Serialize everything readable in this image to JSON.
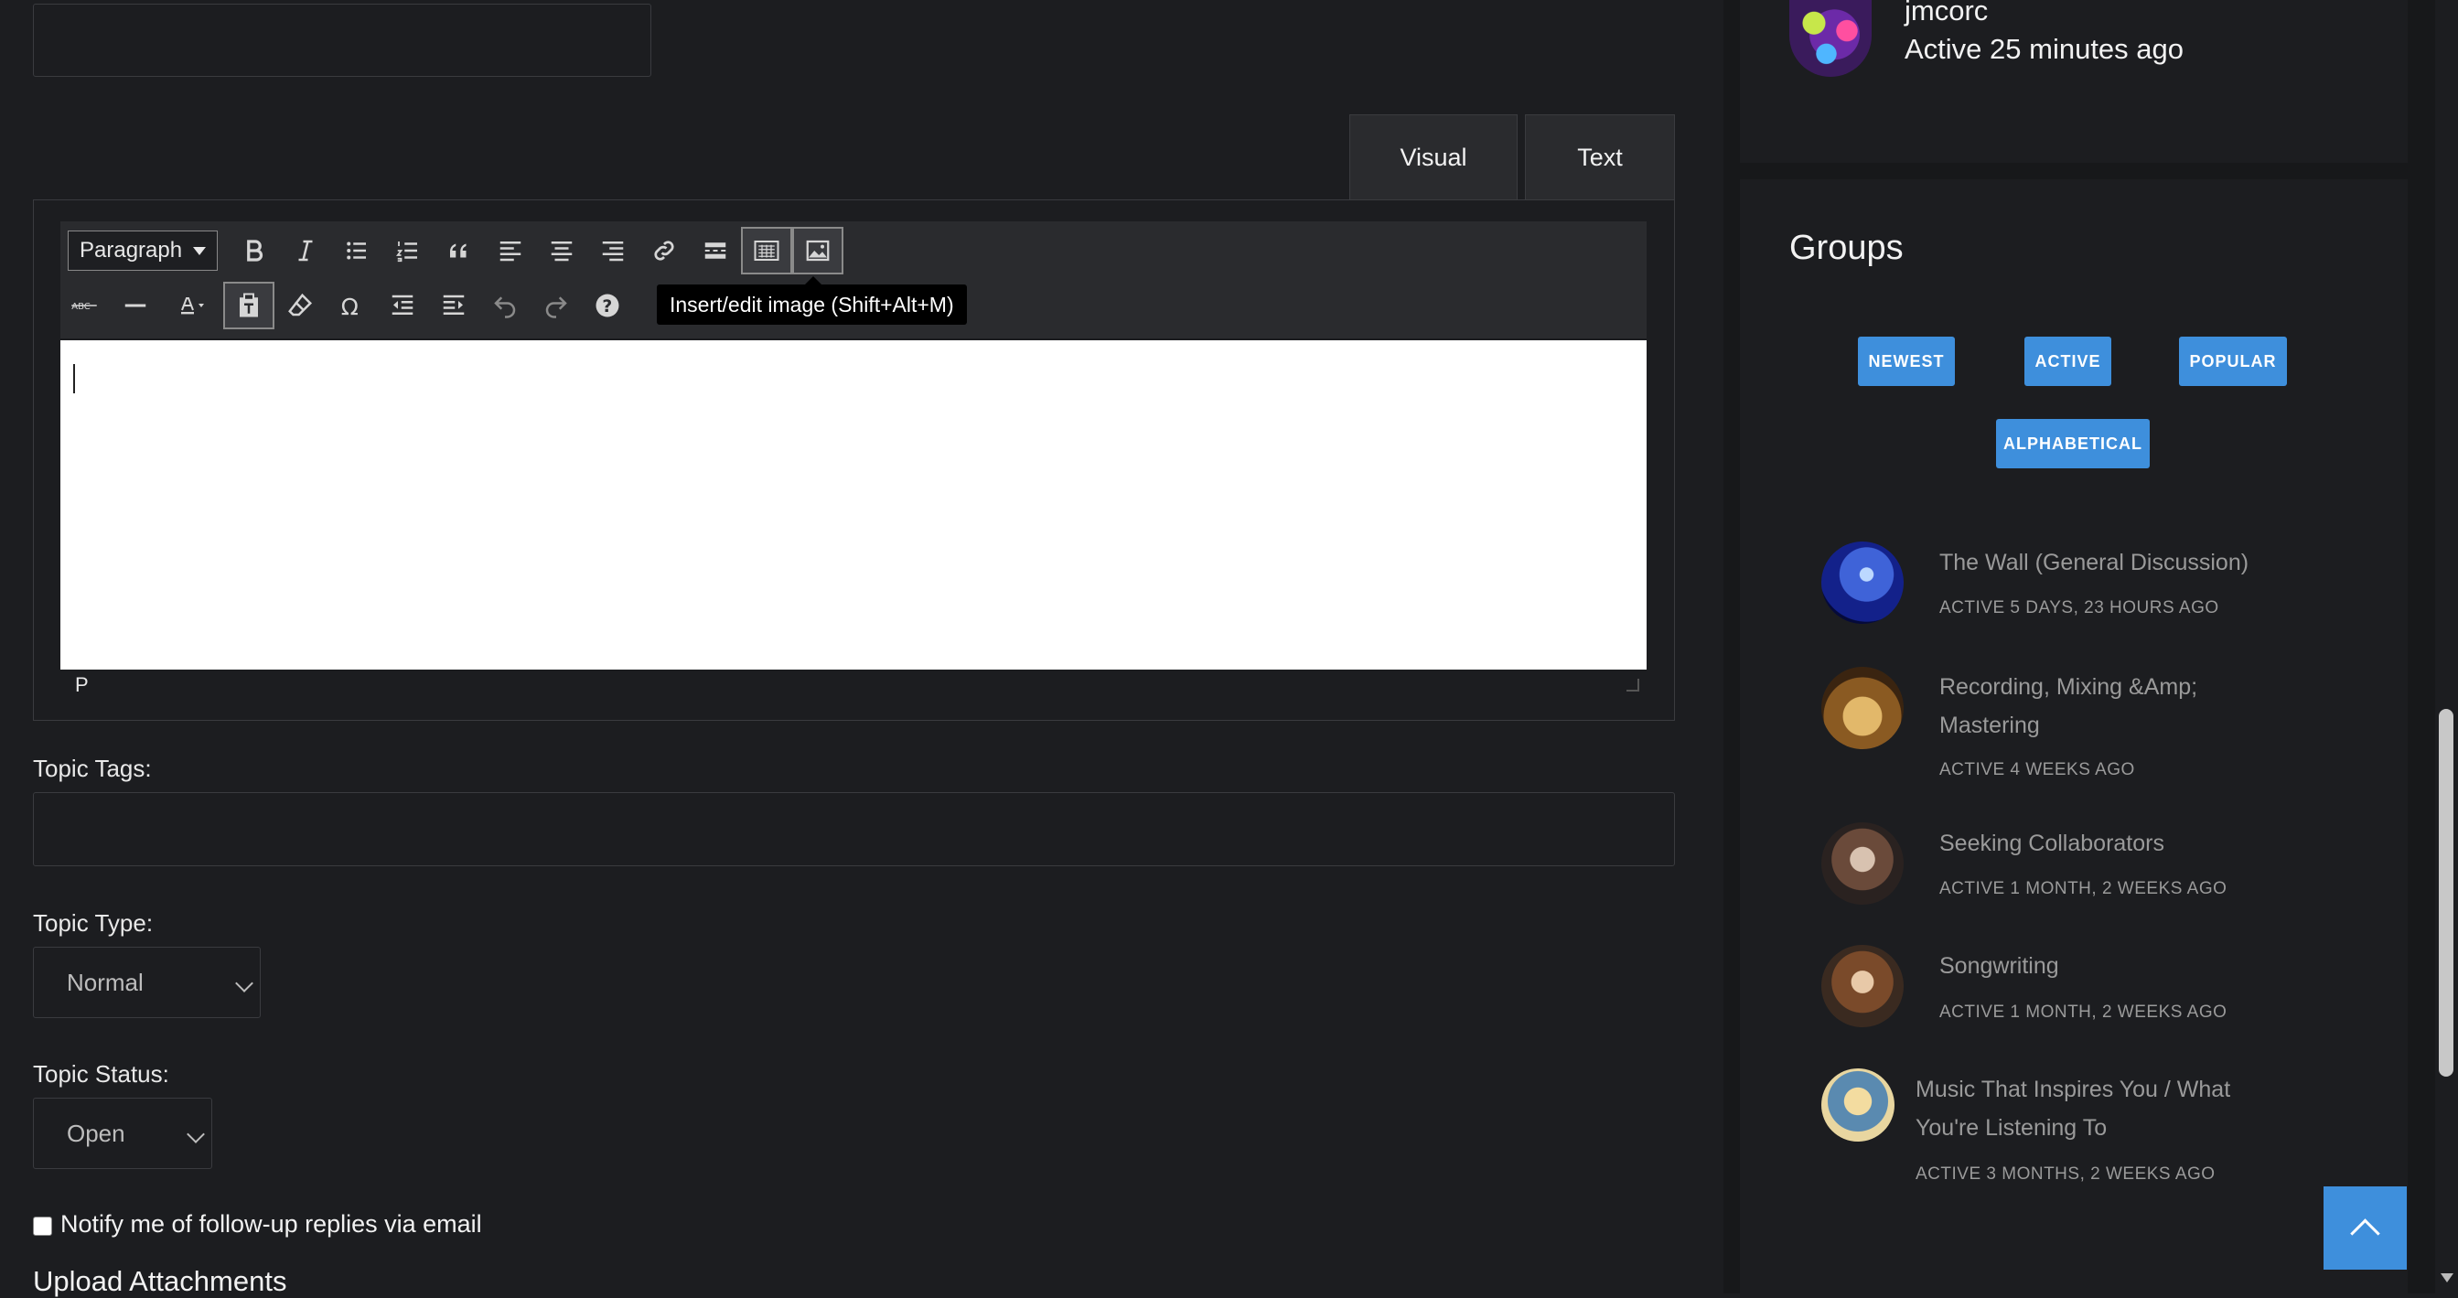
{
  "editor": {
    "tabs": {
      "visual": "Visual",
      "text": "Text"
    },
    "format_select": "Paragraph",
    "tooltip": "Insert/edit image (Shift+Alt+M)",
    "path": "P",
    "toolbar_row1": [
      "bold-icon",
      "italic-icon",
      "bullet-list-icon",
      "numbered-list-icon",
      "blockquote-icon",
      "align-left-icon",
      "align-center-icon",
      "align-right-icon",
      "link-icon",
      "read-more-icon",
      "toolbar-toggle-icon",
      "image-icon"
    ],
    "toolbar_row2": [
      "strikethrough-icon",
      "horizontal-line-icon",
      "text-color-icon",
      "paste-text-icon",
      "clear-formatting-icon",
      "special-character-icon",
      "outdent-icon",
      "indent-icon",
      "undo-icon",
      "redo-icon",
      "help-icon"
    ]
  },
  "form": {
    "topic_tags_label": "Topic Tags:",
    "topic_type_label": "Topic Type:",
    "topic_type_value": "Normal",
    "topic_status_label": "Topic Status:",
    "topic_status_value": "Open",
    "notify_label": "Notify me of follow-up replies via email",
    "upload_label": "Upload Attachments"
  },
  "sidebar": {
    "user": {
      "name": "jmcorc",
      "active": "Active 25 minutes ago"
    },
    "groups": {
      "title": "Groups",
      "filters": [
        "NEWEST",
        "ACTIVE",
        "POPULAR",
        "ALPHABETICAL"
      ],
      "items": [
        {
          "name": "The Wall (General Discussion)",
          "meta": "ACTIVE 5 DAYS, 23 HOURS AGO"
        },
        {
          "name_line1": "Recording, Mixing &Amp;",
          "name_line2": "Mastering",
          "meta": "ACTIVE 4 WEEKS AGO"
        },
        {
          "name": "Seeking Collaborators",
          "meta": "ACTIVE 1 MONTH, 2 WEEKS AGO"
        },
        {
          "name": "Songwriting",
          "meta": "ACTIVE 1 MONTH, 2 WEEKS AGO"
        },
        {
          "name_line1": "Music That Inspires You / What",
          "name_line2": "You're Listening To",
          "meta": "ACTIVE 3 MONTHS, 2 WEEKS AGO"
        }
      ]
    }
  },
  "colors": {
    "accent": "#3e8fdc",
    "background": "#1c1d20",
    "panel": "#2a2b2e"
  }
}
